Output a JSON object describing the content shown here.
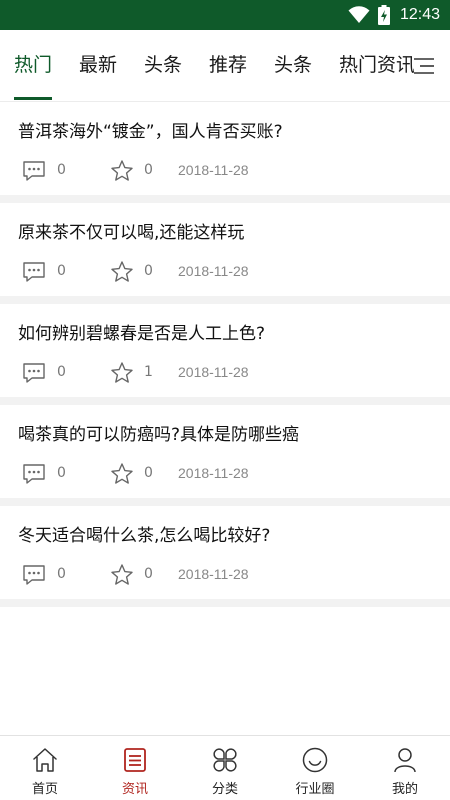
{
  "status_bar": {
    "time": "12:43"
  },
  "tabs": [
    {
      "label": "热门"
    },
    {
      "label": "最新"
    },
    {
      "label": "头条"
    },
    {
      "label": "推荐"
    },
    {
      "label": "头条"
    },
    {
      "label": "热门资讯"
    }
  ],
  "active_tab": "热门",
  "articles": [
    {
      "title": "普洱茶海外“镀金”，国人肯否买账?",
      "comments": "0",
      "stars": "0",
      "date": "2018-11-28"
    },
    {
      "title": "原来茶不仅可以喝,还能这样玩",
      "comments": "0",
      "stars": "0",
      "date": "2018-11-28"
    },
    {
      "title": "如何辨别碧螺春是否是人工上色?",
      "comments": "0",
      "stars": "1",
      "date": "2018-11-28"
    },
    {
      "title": "喝茶真的可以防癌吗?具体是防哪些癌",
      "comments": "0",
      "stars": "0",
      "date": "2018-11-28"
    },
    {
      "title": "冬天适合喝什么茶,怎么喝比较好?",
      "comments": "0",
      "stars": "0",
      "date": "2018-11-28"
    }
  ],
  "bottom_nav": [
    {
      "label": "首页",
      "icon": "home-icon"
    },
    {
      "label": "资讯",
      "icon": "news-icon"
    },
    {
      "label": "分类",
      "icon": "category-icon"
    },
    {
      "label": "行业圈",
      "icon": "circle-icon"
    },
    {
      "label": "我的",
      "icon": "profile-icon"
    }
  ],
  "active_nav": "资讯",
  "colors": {
    "brand": "#0f5a2a",
    "nav_active": "#b0251f",
    "divider": "#f2f2f2"
  }
}
